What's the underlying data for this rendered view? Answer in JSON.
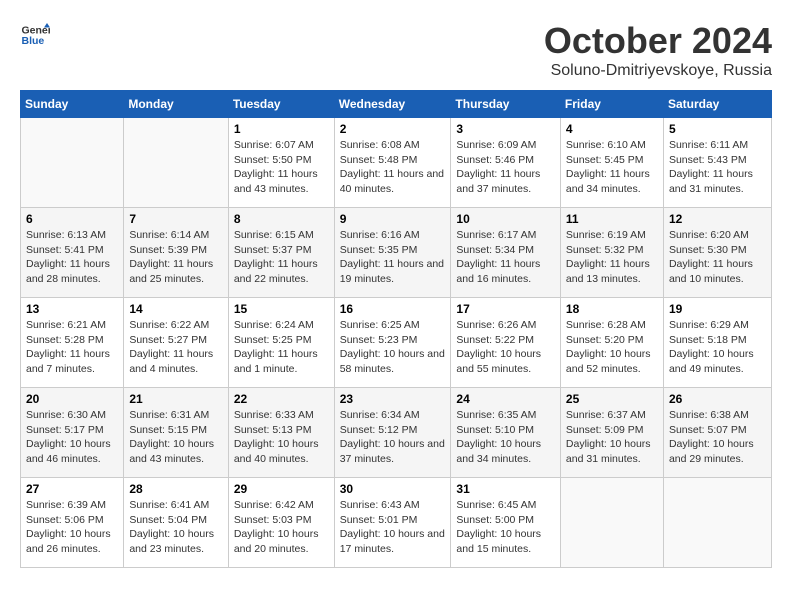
{
  "header": {
    "logo_line1": "General",
    "logo_line2": "Blue",
    "month": "October 2024",
    "location": "Soluno-Dmitriyevskoye, Russia"
  },
  "days_of_week": [
    "Sunday",
    "Monday",
    "Tuesday",
    "Wednesday",
    "Thursday",
    "Friday",
    "Saturday"
  ],
  "weeks": [
    [
      {
        "day": "",
        "sunrise": "",
        "sunset": "",
        "daylight": ""
      },
      {
        "day": "",
        "sunrise": "",
        "sunset": "",
        "daylight": ""
      },
      {
        "day": "1",
        "sunrise": "Sunrise: 6:07 AM",
        "sunset": "Sunset: 5:50 PM",
        "daylight": "Daylight: 11 hours and 43 minutes."
      },
      {
        "day": "2",
        "sunrise": "Sunrise: 6:08 AM",
        "sunset": "Sunset: 5:48 PM",
        "daylight": "Daylight: 11 hours and 40 minutes."
      },
      {
        "day": "3",
        "sunrise": "Sunrise: 6:09 AM",
        "sunset": "Sunset: 5:46 PM",
        "daylight": "Daylight: 11 hours and 37 minutes."
      },
      {
        "day": "4",
        "sunrise": "Sunrise: 6:10 AM",
        "sunset": "Sunset: 5:45 PM",
        "daylight": "Daylight: 11 hours and 34 minutes."
      },
      {
        "day": "5",
        "sunrise": "Sunrise: 6:11 AM",
        "sunset": "Sunset: 5:43 PM",
        "daylight": "Daylight: 11 hours and 31 minutes."
      }
    ],
    [
      {
        "day": "6",
        "sunrise": "Sunrise: 6:13 AM",
        "sunset": "Sunset: 5:41 PM",
        "daylight": "Daylight: 11 hours and 28 minutes."
      },
      {
        "day": "7",
        "sunrise": "Sunrise: 6:14 AM",
        "sunset": "Sunset: 5:39 PM",
        "daylight": "Daylight: 11 hours and 25 minutes."
      },
      {
        "day": "8",
        "sunrise": "Sunrise: 6:15 AM",
        "sunset": "Sunset: 5:37 PM",
        "daylight": "Daylight: 11 hours and 22 minutes."
      },
      {
        "day": "9",
        "sunrise": "Sunrise: 6:16 AM",
        "sunset": "Sunset: 5:35 PM",
        "daylight": "Daylight: 11 hours and 19 minutes."
      },
      {
        "day": "10",
        "sunrise": "Sunrise: 6:17 AM",
        "sunset": "Sunset: 5:34 PM",
        "daylight": "Daylight: 11 hours and 16 minutes."
      },
      {
        "day": "11",
        "sunrise": "Sunrise: 6:19 AM",
        "sunset": "Sunset: 5:32 PM",
        "daylight": "Daylight: 11 hours and 13 minutes."
      },
      {
        "day": "12",
        "sunrise": "Sunrise: 6:20 AM",
        "sunset": "Sunset: 5:30 PM",
        "daylight": "Daylight: 11 hours and 10 minutes."
      }
    ],
    [
      {
        "day": "13",
        "sunrise": "Sunrise: 6:21 AM",
        "sunset": "Sunset: 5:28 PM",
        "daylight": "Daylight: 11 hours and 7 minutes."
      },
      {
        "day": "14",
        "sunrise": "Sunrise: 6:22 AM",
        "sunset": "Sunset: 5:27 PM",
        "daylight": "Daylight: 11 hours and 4 minutes."
      },
      {
        "day": "15",
        "sunrise": "Sunrise: 6:24 AM",
        "sunset": "Sunset: 5:25 PM",
        "daylight": "Daylight: 11 hours and 1 minute."
      },
      {
        "day": "16",
        "sunrise": "Sunrise: 6:25 AM",
        "sunset": "Sunset: 5:23 PM",
        "daylight": "Daylight: 10 hours and 58 minutes."
      },
      {
        "day": "17",
        "sunrise": "Sunrise: 6:26 AM",
        "sunset": "Sunset: 5:22 PM",
        "daylight": "Daylight: 10 hours and 55 minutes."
      },
      {
        "day": "18",
        "sunrise": "Sunrise: 6:28 AM",
        "sunset": "Sunset: 5:20 PM",
        "daylight": "Daylight: 10 hours and 52 minutes."
      },
      {
        "day": "19",
        "sunrise": "Sunrise: 6:29 AM",
        "sunset": "Sunset: 5:18 PM",
        "daylight": "Daylight: 10 hours and 49 minutes."
      }
    ],
    [
      {
        "day": "20",
        "sunrise": "Sunrise: 6:30 AM",
        "sunset": "Sunset: 5:17 PM",
        "daylight": "Daylight: 10 hours and 46 minutes."
      },
      {
        "day": "21",
        "sunrise": "Sunrise: 6:31 AM",
        "sunset": "Sunset: 5:15 PM",
        "daylight": "Daylight: 10 hours and 43 minutes."
      },
      {
        "day": "22",
        "sunrise": "Sunrise: 6:33 AM",
        "sunset": "Sunset: 5:13 PM",
        "daylight": "Daylight: 10 hours and 40 minutes."
      },
      {
        "day": "23",
        "sunrise": "Sunrise: 6:34 AM",
        "sunset": "Sunset: 5:12 PM",
        "daylight": "Daylight: 10 hours and 37 minutes."
      },
      {
        "day": "24",
        "sunrise": "Sunrise: 6:35 AM",
        "sunset": "Sunset: 5:10 PM",
        "daylight": "Daylight: 10 hours and 34 minutes."
      },
      {
        "day": "25",
        "sunrise": "Sunrise: 6:37 AM",
        "sunset": "Sunset: 5:09 PM",
        "daylight": "Daylight: 10 hours and 31 minutes."
      },
      {
        "day": "26",
        "sunrise": "Sunrise: 6:38 AM",
        "sunset": "Sunset: 5:07 PM",
        "daylight": "Daylight: 10 hours and 29 minutes."
      }
    ],
    [
      {
        "day": "27",
        "sunrise": "Sunrise: 6:39 AM",
        "sunset": "Sunset: 5:06 PM",
        "daylight": "Daylight: 10 hours and 26 minutes."
      },
      {
        "day": "28",
        "sunrise": "Sunrise: 6:41 AM",
        "sunset": "Sunset: 5:04 PM",
        "daylight": "Daylight: 10 hours and 23 minutes."
      },
      {
        "day": "29",
        "sunrise": "Sunrise: 6:42 AM",
        "sunset": "Sunset: 5:03 PM",
        "daylight": "Daylight: 10 hours and 20 minutes."
      },
      {
        "day": "30",
        "sunrise": "Sunrise: 6:43 AM",
        "sunset": "Sunset: 5:01 PM",
        "daylight": "Daylight: 10 hours and 17 minutes."
      },
      {
        "day": "31",
        "sunrise": "Sunrise: 6:45 AM",
        "sunset": "Sunset: 5:00 PM",
        "daylight": "Daylight: 10 hours and 15 minutes."
      },
      {
        "day": "",
        "sunrise": "",
        "sunset": "",
        "daylight": ""
      },
      {
        "day": "",
        "sunrise": "",
        "sunset": "",
        "daylight": ""
      }
    ]
  ]
}
